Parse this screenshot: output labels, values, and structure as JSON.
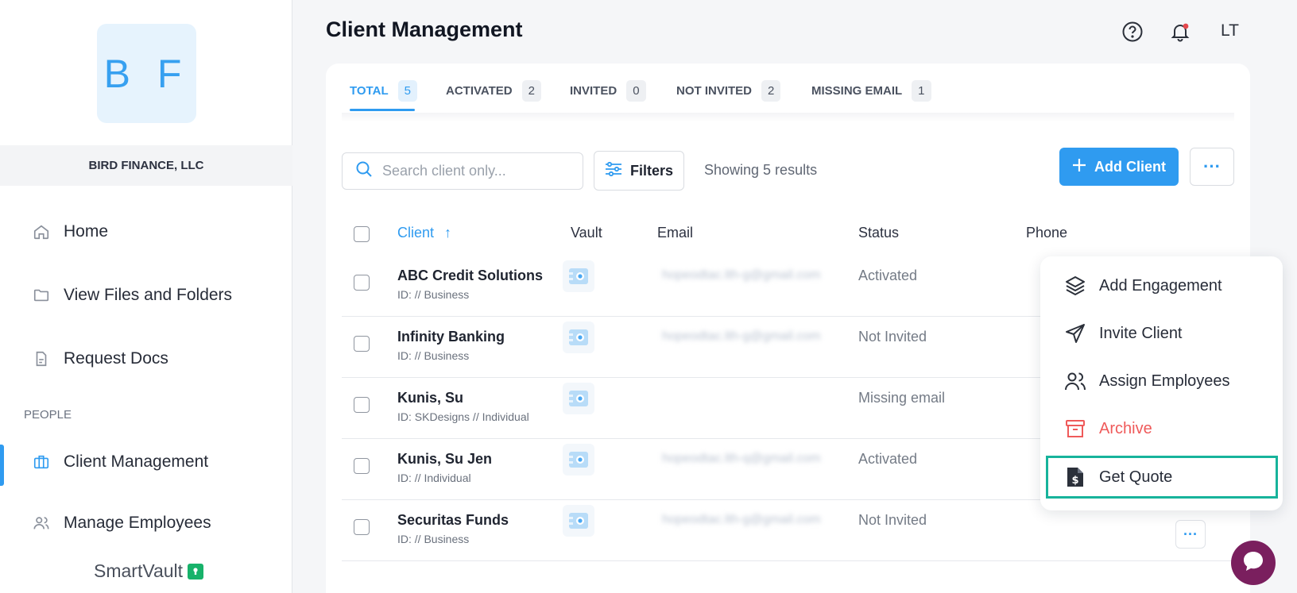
{
  "sidebar": {
    "logo_initials": "B F",
    "org_name": "BIRD FINANCE, LLC",
    "nav": [
      {
        "label": "Home",
        "icon": "home-icon"
      },
      {
        "label": "View Files and Folders",
        "icon": "folder-icon"
      },
      {
        "label": "Request Docs",
        "icon": "document-icon"
      }
    ],
    "section_people": "PEOPLE",
    "people_nav": [
      {
        "label": "Client Management",
        "icon": "briefcase-icon",
        "active": true
      },
      {
        "label": "Manage Employees",
        "icon": "users-icon"
      }
    ],
    "brand": "SmartVault"
  },
  "header": {
    "title": "Client Management",
    "help_icon": "help-circle-icon",
    "notification_icon": "bell-icon",
    "user_initials": "LT"
  },
  "tabs": [
    {
      "label": "TOTAL",
      "count": "5",
      "active": true
    },
    {
      "label": "ACTIVATED",
      "count": "2"
    },
    {
      "label": "INVITED",
      "count": "0"
    },
    {
      "label": "NOT INVITED",
      "count": "2"
    },
    {
      "label": "MISSING EMAIL",
      "count": "1"
    }
  ],
  "toolbar": {
    "search_placeholder": "Search client only...",
    "filters_label": "Filters",
    "results_text": "Showing 5 results",
    "add_client_label": "Add Client",
    "more_label": "···"
  },
  "table": {
    "columns": [
      "Client",
      "Vault",
      "Email",
      "Status",
      "Phone"
    ],
    "sort_arrow": "↑",
    "rows": [
      {
        "name": "ABC Credit Solutions",
        "id": "ID: // Business",
        "email": "hopeodtac.lth-g@gmail.com",
        "status": "Activated"
      },
      {
        "name": "Infinity Banking",
        "id": "ID: // Business",
        "email": "hopeodtac.lth-g@gmail.com",
        "status": "Not Invited"
      },
      {
        "name": "Kunis, Su",
        "id": "ID: SKDesigns // Individual",
        "email": "",
        "status": "Missing email"
      },
      {
        "name": "Kunis, Su Jen",
        "id": "ID: // Individual",
        "email": "hopeodtac.lth-q@gmail.com",
        "status": "Activated"
      },
      {
        "name": "Securitas Funds",
        "id": "ID: // Business",
        "email": "hopeodtac.lth-g@gmail.com",
        "status": "Not Invited"
      }
    ],
    "row_more_label": "···"
  },
  "menu": {
    "items": [
      {
        "label": "Add Engagement",
        "icon": "layers-icon"
      },
      {
        "label": "Invite Client",
        "icon": "send-icon"
      },
      {
        "label": "Assign Employees",
        "icon": "users-icon"
      },
      {
        "label": "Archive",
        "icon": "archive-icon",
        "danger": true
      },
      {
        "label": "Get Quote",
        "icon": "dollar-file-icon",
        "highlighted": true
      }
    ]
  },
  "colors": {
    "accent": "#2f9bf0",
    "danger": "#ef5a5a",
    "highlight": "#17b39b",
    "chat": "#7a1f5e",
    "brand_lock": "#17b26a"
  },
  "chat_icon": "chat-bubble-icon"
}
